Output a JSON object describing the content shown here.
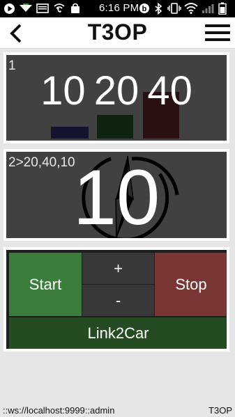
{
  "status_bar": {
    "time": "6:16 PM",
    "icons": [
      "play-icon",
      "download-icon",
      "email-icon",
      "wifi-call-icon",
      "bag-icon",
      "beats-icon",
      "bluetooth-icon",
      "vibrate-icon",
      "wifi-icon",
      "signal-icon",
      "battery-icon"
    ]
  },
  "header": {
    "title": "T3OP",
    "back_icon": "back-arrow-icon",
    "menu_icon": "hamburger-menu-icon"
  },
  "panel_values": {
    "label": "1",
    "values_text": "10 20 40",
    "bars": [
      {
        "value": 10,
        "color": "#14142e"
      },
      {
        "value": 20,
        "color": "#0e2410"
      },
      {
        "value": 40,
        "color": "#2a1111"
      }
    ]
  },
  "panel_countdown": {
    "label": "2>20,40,10",
    "count": "10",
    "icon": "compass-icon"
  },
  "controls": {
    "start_label": "Start",
    "plus_label": "+",
    "minus_label": "-",
    "stop_label": "Stop",
    "link_label": "Link2Car"
  },
  "footer": {
    "connection": "::ws://localhost:9999::admin",
    "app_name": "T3OP"
  },
  "colors": {
    "start": "#3b7e3b",
    "stop": "#7a3535",
    "link": "#254b22",
    "panel": "#414141"
  }
}
